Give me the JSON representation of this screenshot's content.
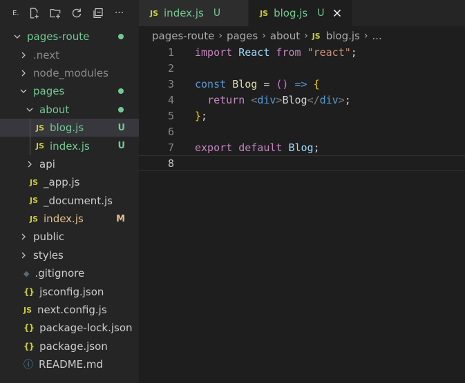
{
  "sidebar": {
    "title": "E.",
    "header_icons": [
      "new-file-icon",
      "new-folder-icon",
      "refresh-icon",
      "collapse-all-icon",
      "more-icon"
    ],
    "more_label": "···",
    "items": [
      {
        "label": "pages-route",
        "kind": "folder-open",
        "depth": 0,
        "badge": "dot",
        "color": "green"
      },
      {
        "label": ".next",
        "kind": "folder-closed",
        "depth": 1,
        "badge": "",
        "color": "dim"
      },
      {
        "label": "node_modules",
        "kind": "folder-closed",
        "depth": 1,
        "badge": "",
        "color": "dim"
      },
      {
        "label": "pages",
        "kind": "folder-open",
        "depth": 1,
        "badge": "dot",
        "color": "green"
      },
      {
        "label": "about",
        "kind": "folder-open",
        "depth": 2,
        "badge": "dot",
        "color": "green"
      },
      {
        "label": "blog.js",
        "kind": "js",
        "depth": 3,
        "badge": "U",
        "color": "green",
        "selected": true
      },
      {
        "label": "index.js",
        "kind": "js",
        "depth": 3,
        "badge": "U",
        "color": "green"
      },
      {
        "label": "api",
        "kind": "folder-closed",
        "depth": 2,
        "badge": "",
        "color": "normal"
      },
      {
        "label": "_app.js",
        "kind": "js",
        "depth": 2,
        "badge": "",
        "color": "normal"
      },
      {
        "label": "_document.js",
        "kind": "js",
        "depth": 2,
        "badge": "",
        "color": "normal"
      },
      {
        "label": "index.js",
        "kind": "js",
        "depth": 2,
        "badge": "M",
        "color": "yellow"
      },
      {
        "label": "public",
        "kind": "folder-closed",
        "depth": 1,
        "badge": "",
        "color": "normal"
      },
      {
        "label": "styles",
        "kind": "folder-closed",
        "depth": 1,
        "badge": "",
        "color": "normal"
      },
      {
        "label": ".gitignore",
        "kind": "git",
        "depth": 1,
        "badge": "",
        "color": "normal"
      },
      {
        "label": "jsconfig.json",
        "kind": "json",
        "depth": 1,
        "badge": "",
        "color": "normal"
      },
      {
        "label": "next.config.js",
        "kind": "js",
        "depth": 1,
        "badge": "",
        "color": "normal"
      },
      {
        "label": "package-lock.json",
        "kind": "json",
        "depth": 1,
        "badge": "",
        "color": "normal"
      },
      {
        "label": "package.json",
        "kind": "json",
        "depth": 1,
        "badge": "",
        "color": "normal"
      },
      {
        "label": "README.md",
        "kind": "info",
        "depth": 1,
        "badge": "",
        "color": "normal"
      }
    ]
  },
  "tabs": [
    {
      "icon": "JS",
      "label": "index.js",
      "status": "U",
      "active": false
    },
    {
      "icon": "JS",
      "label": "blog.js",
      "status": "U",
      "active": true
    }
  ],
  "breadcrumb": {
    "items": [
      "pages-route",
      "pages",
      "about",
      "blog.js",
      "..."
    ],
    "file_icon": "JS"
  },
  "editor": {
    "current_line": 8,
    "lines": [
      {
        "n": "1",
        "tokens": [
          [
            "import",
            "k-ctrl"
          ],
          [
            " ",
            "k-pun"
          ],
          [
            "React",
            "k-var"
          ],
          [
            " ",
            "k-pun"
          ],
          [
            "from",
            "k-ctrl"
          ],
          [
            " ",
            "k-pun"
          ],
          [
            "\"react\"",
            "k-str"
          ],
          [
            ";",
            "k-pun"
          ]
        ]
      },
      {
        "n": "2",
        "tokens": []
      },
      {
        "n": "3",
        "tokens": [
          [
            "const",
            "k-kw"
          ],
          [
            " ",
            "k-pun"
          ],
          [
            "Blog",
            "k-fn"
          ],
          [
            " = ",
            "k-pun"
          ],
          [
            "()",
            "k-br2"
          ],
          [
            " ",
            "k-pun"
          ],
          [
            "=>",
            "k-kw"
          ],
          [
            " ",
            "k-pun"
          ],
          [
            "{",
            "k-br"
          ]
        ]
      },
      {
        "n": "4",
        "tokens": [
          [
            "  ",
            "k-pun"
          ],
          [
            "return",
            "k-ctrl"
          ],
          [
            " ",
            "k-pun"
          ],
          [
            "<",
            "k-tag"
          ],
          [
            "div",
            "k-tagn"
          ],
          [
            ">",
            "k-tag"
          ],
          [
            "Blog",
            "k-txt"
          ],
          [
            "</",
            "k-tag"
          ],
          [
            "div",
            "k-tagn"
          ],
          [
            ">",
            "k-tag"
          ],
          [
            ";",
            "k-pun"
          ]
        ]
      },
      {
        "n": "5",
        "tokens": [
          [
            "}",
            "k-br"
          ],
          [
            ";",
            "k-pun"
          ]
        ]
      },
      {
        "n": "6",
        "tokens": []
      },
      {
        "n": "7",
        "tokens": [
          [
            "export",
            "k-ctrl"
          ],
          [
            " ",
            "k-pun"
          ],
          [
            "default",
            "k-ctrl"
          ],
          [
            " ",
            "k-pun"
          ],
          [
            "Blog",
            "k-var"
          ],
          [
            ";",
            "k-pun"
          ]
        ]
      },
      {
        "n": "8",
        "tokens": []
      }
    ]
  },
  "colors": {
    "background": "#1e1e1e",
    "sidebar": "#252526",
    "selected_row": "#37373d",
    "untracked": "#73c991",
    "modified": "#e2c08d",
    "js_icon": "#cbcb41"
  }
}
